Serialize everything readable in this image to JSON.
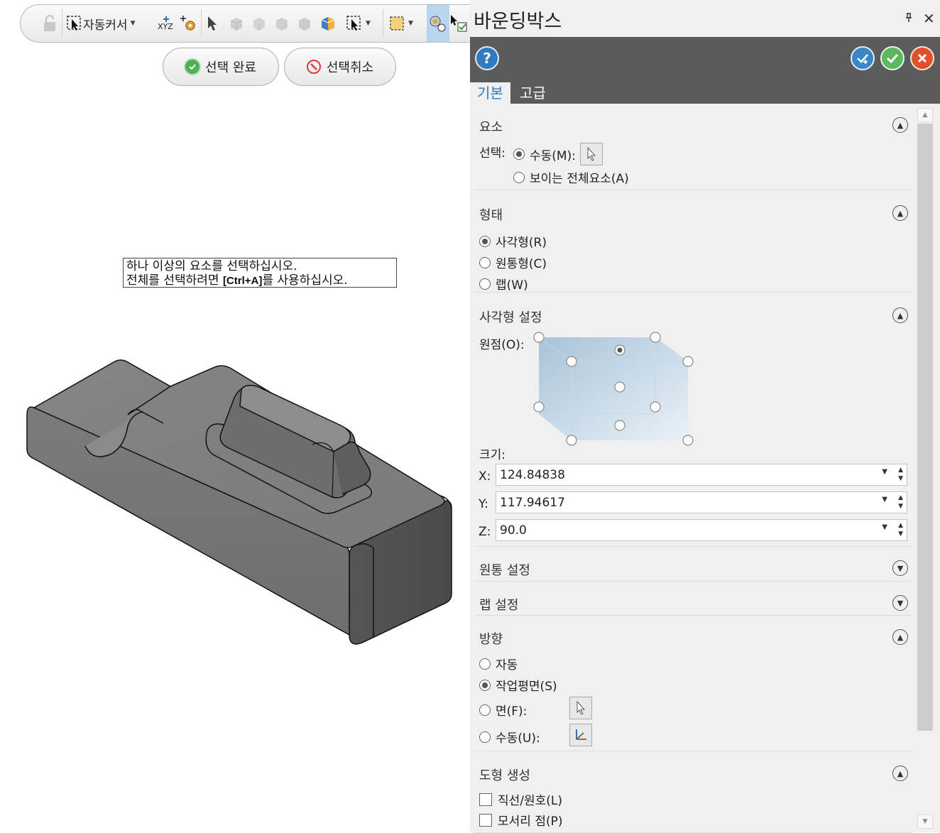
{
  "toolbar": {
    "auto_cursor_label": "자동커서"
  },
  "actions": {
    "complete_label": "선택 완료",
    "cancel_label": "선택취소"
  },
  "hint": {
    "line1": "하나 이상의 요소를 선택하십시오.",
    "line2_prefix": "전체를 선택하려면 ",
    "line2_key": "[Ctrl+A]",
    "line2_suffix": "를 사용하십시오."
  },
  "panel": {
    "title": "바운딩박스",
    "pin_icon": "pin-icon",
    "close_symbol": "✕",
    "tabs": [
      "기본",
      "고급"
    ],
    "elements": {
      "title": "요소",
      "select_label": "선택:",
      "manual": "수동(M):",
      "all_visible": "보이는 전체요소(A)"
    },
    "shape": {
      "title": "형태",
      "options": [
        "사각형(R)",
        "원통형(C)",
        "랩(W)"
      ],
      "selected": 0
    },
    "rect_settings": {
      "title": "사각형 설정",
      "origin_label": "원점(O):",
      "size_label": "크기:",
      "x_label": "X:",
      "x_value": "124.84838",
      "y_label": "Y:",
      "y_value": "117.94617",
      "z_label": "Z:",
      "z_value": "90.0"
    },
    "cylinder_settings": {
      "title": "원통 설정"
    },
    "wrap_settings": {
      "title": "랩 설정"
    },
    "direction": {
      "title": "방향",
      "options": [
        "자동",
        "작업평면(S)",
        "면(F):",
        "수동(U):"
      ],
      "selected": 1
    },
    "geometry": {
      "title": "도형 생성",
      "options": [
        "직선/원호(L)",
        "모서리 점(P)"
      ]
    }
  },
  "colors": {
    "header_bg": "#5b5b5b",
    "accent": "#2b7bc4",
    "ok_green": "#5cb85c",
    "cancel_red": "#e0502b"
  }
}
